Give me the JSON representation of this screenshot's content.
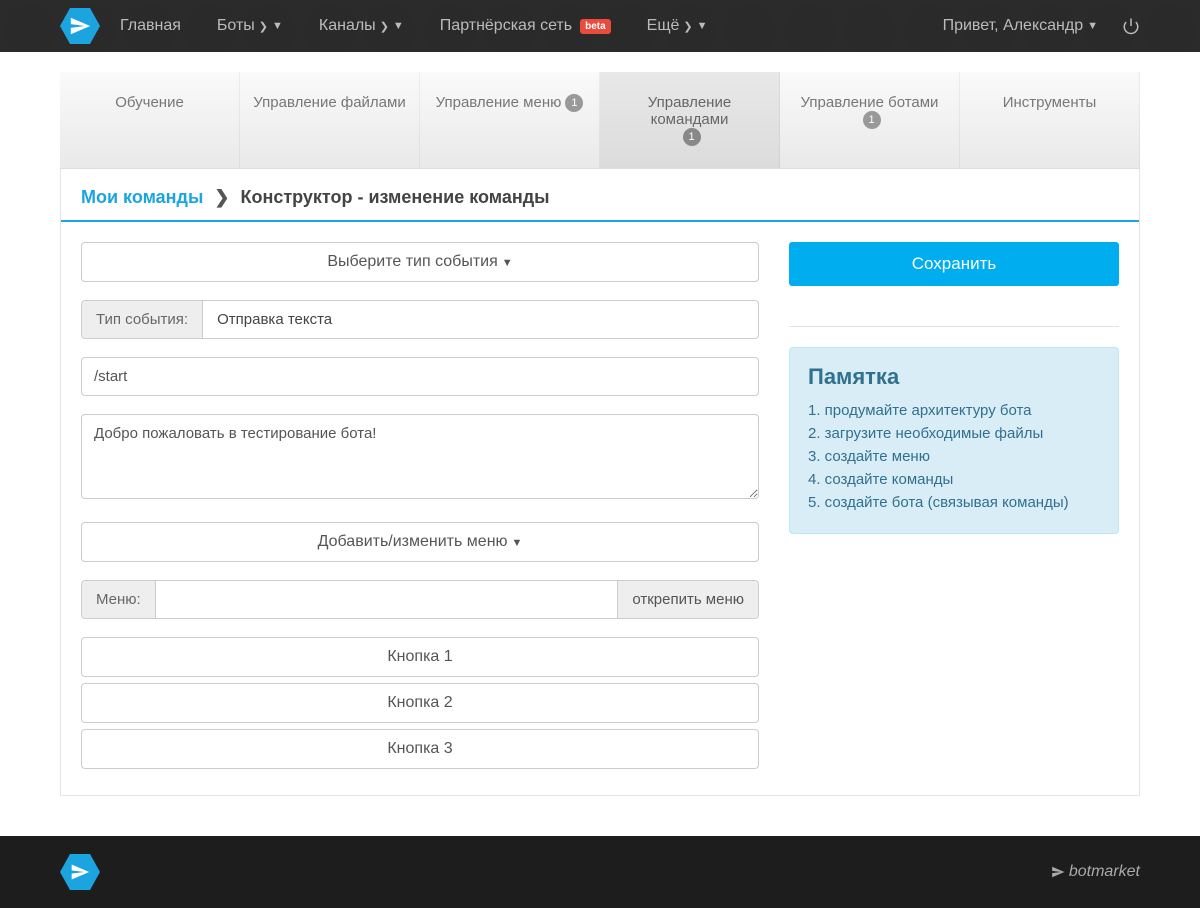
{
  "nav": {
    "items": [
      {
        "label": "Главная"
      },
      {
        "label": "Боты",
        "dropdown": true
      },
      {
        "label": "Каналы",
        "dropdown": true
      },
      {
        "label": "Партнёрская сеть",
        "beta": "beta"
      },
      {
        "label": "Ещё",
        "dropdown": true
      }
    ],
    "greeting": "Привет, Александр"
  },
  "tabs": [
    {
      "label": "Обучение"
    },
    {
      "label": "Управление файлами"
    },
    {
      "label": "Управление меню",
      "badge": "1"
    },
    {
      "label": "Управление командами",
      "badge": "1",
      "active": true
    },
    {
      "label": "Управление ботами",
      "badge": "1"
    },
    {
      "label": "Инструменты"
    }
  ],
  "breadcrumb": {
    "link": "Мои команды",
    "current": "Конструктор - изменение команды"
  },
  "form": {
    "event_type_dropdown": "Выберите тип события",
    "event_type_label": "Тип события:",
    "event_type_value": "Отправка текста",
    "command_value": "/start",
    "message_value": "Добро пожаловать в тестирование бота!",
    "menu_dropdown": "Добавить/изменить меню",
    "menu_label": "Меню:",
    "menu_detach": "открепить меню",
    "buttons": [
      "Кнопка 1",
      "Кнопка 2",
      "Кнопка 3"
    ]
  },
  "sidebar": {
    "save": "Сохранить",
    "memo_title": "Памятка",
    "memo_items": [
      "1. продумайте архитектуру бота",
      "2. загрузите необходимые файлы",
      "3. создайте меню",
      "4. создайте команды",
      "5. создайте бота (связывая команды)"
    ]
  },
  "footer": {
    "brand": "botmarket"
  }
}
